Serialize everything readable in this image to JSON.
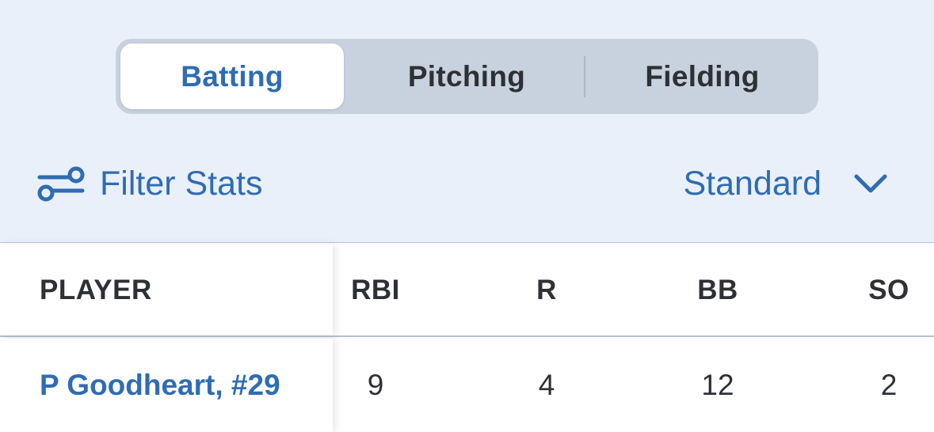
{
  "segments": {
    "batting": "Batting",
    "pitching": "Pitching",
    "fielding": "Fielding",
    "selected": "Batting"
  },
  "toolbar": {
    "filter_label": "Filter Stats",
    "filter_icon": "sliders-icon",
    "view_label": "Standard",
    "view_icon": "chevron-down-icon"
  },
  "table": {
    "columns": [
      "PLAYER",
      "RBI",
      "R",
      "BB",
      "SO"
    ],
    "rows": [
      {
        "player": "P Goodheart, #29",
        "rbi": "9",
        "r": "4",
        "bb": "12",
        "so": "2"
      }
    ]
  },
  "colors": {
    "accent": "#2f6cb3",
    "header_bg": "#eaf0f9",
    "segment_bg": "#c8d2de",
    "text": "#2d3136"
  }
}
